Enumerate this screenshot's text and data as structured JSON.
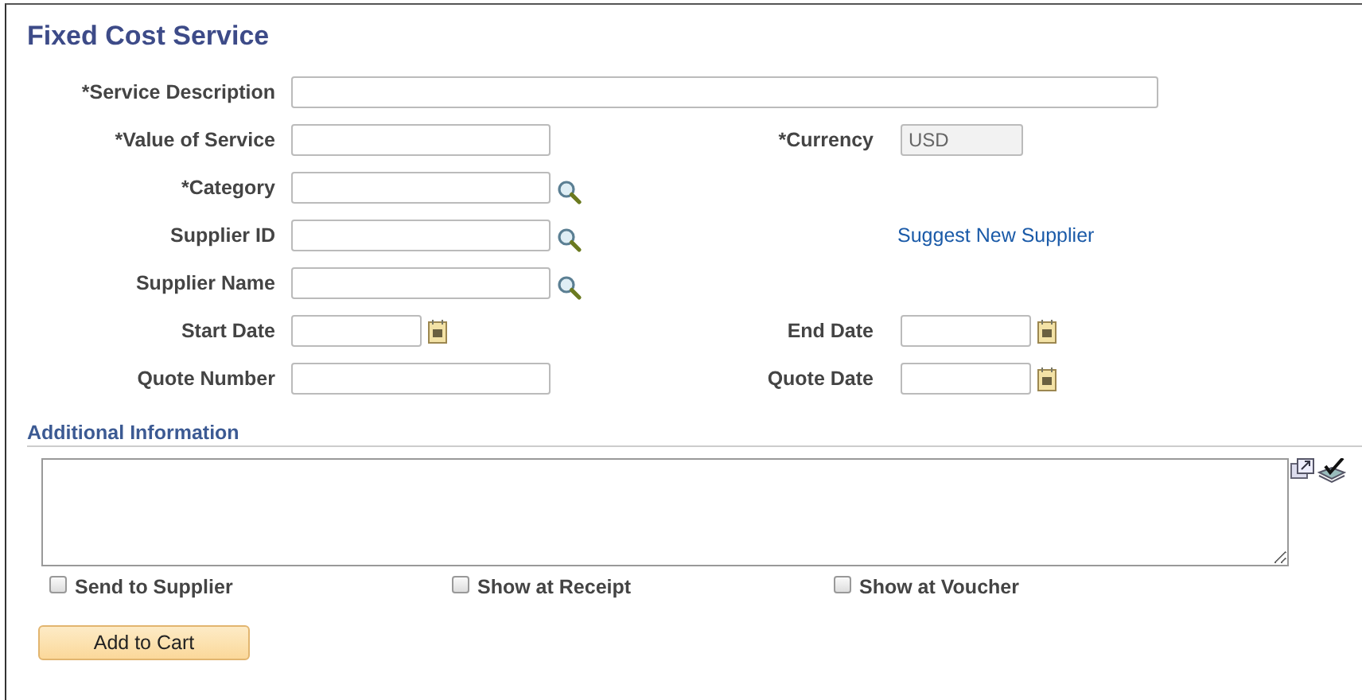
{
  "title": "Fixed Cost Service",
  "rows": [
    {
      "left": {
        "label": "*Service Description",
        "kind": "wide"
      }
    },
    {
      "left": {
        "label": "*Value of Service",
        "kind": "text"
      },
      "right": {
        "kind": "field",
        "label": "*Currency",
        "field": {
          "kind": "readonly",
          "value": "USD"
        }
      }
    },
    {
      "left": {
        "label": "*Category",
        "kind": "lookup"
      }
    },
    {
      "left": {
        "label": "Supplier ID",
        "kind": "lookup"
      },
      "right": {
        "kind": "link",
        "text": "Suggest New Supplier"
      }
    },
    {
      "left": {
        "label": "Supplier Name",
        "kind": "lookup"
      }
    },
    {
      "left": {
        "label": "Start Date",
        "kind": "date"
      },
      "right": {
        "kind": "field",
        "label": "End Date",
        "field": {
          "kind": "date"
        }
      }
    },
    {
      "left": {
        "label": "Quote Number",
        "kind": "text"
      },
      "right": {
        "kind": "field",
        "label": "Quote Date",
        "field": {
          "kind": "date"
        }
      }
    }
  ],
  "additional_information": {
    "heading": "Additional Information"
  },
  "options": [
    {
      "label": "Send to Supplier",
      "checked": false
    },
    {
      "label": "Show at Receipt",
      "checked": false
    },
    {
      "label": "Show at Voucher",
      "checked": false
    }
  ],
  "add_button": "Add to Cart"
}
